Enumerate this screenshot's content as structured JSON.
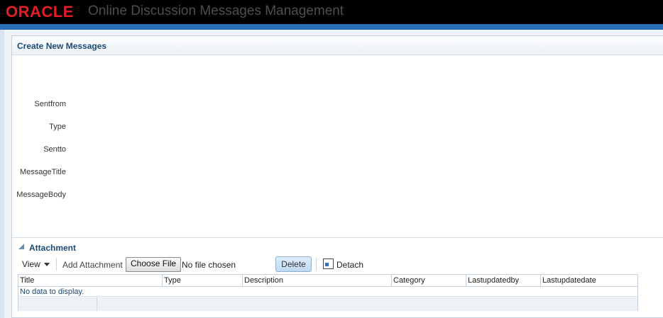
{
  "header": {
    "logo_text": "ORACLE",
    "app_title": "Online Discussion Messages Management"
  },
  "panel": {
    "title": "Create New Messages"
  },
  "form": {
    "fields": [
      "Sentfrom",
      "Type",
      "Sentto",
      "MessageTitle",
      "MessageBody"
    ]
  },
  "attachment": {
    "title": "Attachment",
    "toolbar": {
      "view_label": "View",
      "add_attachment_label": "Add Attachment",
      "choose_file_label": "Choose File",
      "no_file_text": "No file chosen",
      "delete_label": "Delete",
      "detach_label": "Detach"
    },
    "table": {
      "columns": [
        "Title",
        "Type",
        "Description",
        "Category",
        "Lastupdatedby",
        "Lastupdatedate"
      ],
      "empty_text": "No data to display."
    }
  },
  "colors": {
    "brand_red": "#e61c24",
    "accent_blue": "#2b6fb8",
    "title_blue": "#1c4a76"
  }
}
